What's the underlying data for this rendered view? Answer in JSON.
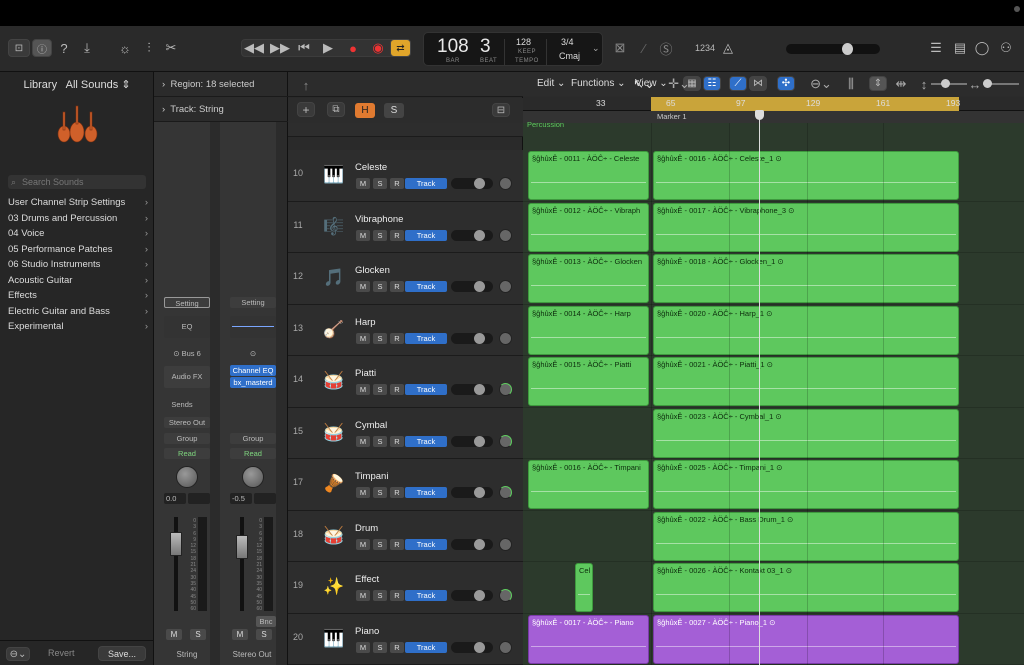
{
  "control_bar": {
    "tempo": "108",
    "bar": "3",
    "bar_label": "BAR",
    "beat_label": "BEAT",
    "tempo_value": "128",
    "keep_label": "KEEP",
    "tempo_label": "TEMPO",
    "signature": "3/4",
    "key": "Cmaj",
    "count_in": "1234"
  },
  "library": {
    "title": "Library",
    "filter": "All Sounds",
    "search_placeholder": "Search Sounds",
    "items": [
      {
        "label": "User Channel Strip Settings"
      },
      {
        "label": "03 Drums and Percussion"
      },
      {
        "label": "04 Voice"
      },
      {
        "label": "05 Performance Patches"
      },
      {
        "label": "06 Studio Instruments"
      },
      {
        "label": "Acoustic Guitar"
      },
      {
        "label": "Effects"
      },
      {
        "label": "Electric Guitar and Bass"
      },
      {
        "label": "Experimental"
      }
    ],
    "revert": "Revert",
    "save": "Save..."
  },
  "inspector": {
    "region_label": "Region:",
    "region_value": "18 selected",
    "track_label": "Track:",
    "track_value": "String",
    "strip1": {
      "setting": "Setting",
      "eq": "EQ",
      "bus": "Bus 6",
      "fx": "Audio FX",
      "sends": "Sends",
      "output": "Stereo Out",
      "group": "Group",
      "read": "Read",
      "vol": "0.0",
      "name": "String"
    },
    "strip2": {
      "setting": "Setting",
      "eq1": "Channel EQ",
      "eq2": "bx_masterd",
      "group": "Group",
      "read": "Read",
      "vol": "-0.5",
      "bnc": "Bnc",
      "name": "Stereo Out"
    },
    "mute": "M",
    "solo": "S",
    "scale": [
      "0",
      "3",
      "6",
      "9",
      "12",
      "15",
      "18",
      "21",
      "24",
      "30",
      "35",
      "40",
      "45",
      "50",
      "60"
    ]
  },
  "arrange_menu": {
    "edit": "Edit",
    "functions": "Functions",
    "view": "View"
  },
  "track_header_tools": {
    "h": "H",
    "s": "S"
  },
  "ruler": {
    "bars": [
      "33",
      "65",
      "97",
      "129",
      "161",
      "193"
    ],
    "marker": "Marker 1",
    "partial_track_label": "Percussion"
  },
  "tracks": [
    {
      "num": "10",
      "name": "Celeste",
      "icon": "🎹",
      "pan_green": false
    },
    {
      "num": "11",
      "name": "Vibraphone",
      "icon": "🎼",
      "pan_green": false
    },
    {
      "num": "12",
      "name": "Glocken",
      "icon": "🎵",
      "pan_green": false
    },
    {
      "num": "13",
      "name": "Harp",
      "icon": "🪕",
      "pan_green": false
    },
    {
      "num": "14",
      "name": "Piatti",
      "icon": "🥁",
      "pan_green": true
    },
    {
      "num": "15",
      "name": "Cymbal",
      "icon": "🥁",
      "pan_green": true
    },
    {
      "num": "17",
      "name": "Timpani",
      "icon": "🪘",
      "pan_green": true
    },
    {
      "num": "18",
      "name": "Drum",
      "icon": "🥁",
      "pan_green": false
    },
    {
      "num": "19",
      "name": "Effect",
      "icon": "✨",
      "pan_green": true
    },
    {
      "num": "20",
      "name": "Piano",
      "icon": "🎹",
      "pan_green": false
    }
  ],
  "track_buttons": {
    "m": "M",
    "s": "S",
    "r": "R",
    "track": "Track"
  },
  "regions": [
    {
      "lane": 0,
      "label": "§ĝhûxÊ - 0011 - ÀÖĈ÷ - Celeste",
      "start": 5,
      "width": 121,
      "purple": false
    },
    {
      "lane": 0,
      "label": "§ĝhûxÊ - 0016 - ÀÖĈ÷ - Celeste_1  ⊙",
      "start": 130,
      "width": 306,
      "purple": false
    },
    {
      "lane": 1,
      "label": "§ĝhûxÊ - 0012 - ÀÖĈ÷ - Vibraph",
      "start": 5,
      "width": 121,
      "purple": false
    },
    {
      "lane": 1,
      "label": "§ĝhûxÊ - 0017 - ÀÖĈ÷ - Vibraphone_3  ⊙",
      "start": 130,
      "width": 306,
      "purple": false
    },
    {
      "lane": 2,
      "label": "§ĝhûxÊ - 0013 - ÀÖĈ÷ - Glocken",
      "start": 5,
      "width": 121,
      "purple": false
    },
    {
      "lane": 2,
      "label": "§ĝhûxÊ - 0018 - ÀÖĈ÷ - Glocken_1  ⊙",
      "start": 130,
      "width": 306,
      "purple": false
    },
    {
      "lane": 3,
      "label": "§ĝhûxÊ - 0014 - ÀÖĈ÷ - Harp",
      "start": 5,
      "width": 121,
      "purple": false
    },
    {
      "lane": 3,
      "label": "§ĝhûxÊ - 0020 - ÀÖĈ÷ - Harp_1  ⊙",
      "start": 130,
      "width": 306,
      "purple": false
    },
    {
      "lane": 4,
      "label": "§ĝhûxÊ - 0015 - ÀÖĈ÷ - Piatti",
      "start": 5,
      "width": 121,
      "purple": false
    },
    {
      "lane": 4,
      "label": "§ĝhûxÊ - 0021 - ÀÖĈ÷ - Piatti_1  ⊙",
      "start": 130,
      "width": 306,
      "purple": false
    },
    {
      "lane": 5,
      "label": "§ĝhûxÊ - 0023 - ÀÖĈ÷ - Cymbal_1  ⊙",
      "start": 130,
      "width": 306,
      "purple": false
    },
    {
      "lane": 6,
      "label": "§ĝhûxÊ - 0016 - ÀÖĈ÷ - Timpani",
      "start": 5,
      "width": 121,
      "purple": false
    },
    {
      "lane": 6,
      "label": "§ĝhûxÊ - 0025 - ÀÖĈ÷ - Timpani_1  ⊙",
      "start": 130,
      "width": 306,
      "purple": false
    },
    {
      "lane": 7,
      "label": "§ĝhûxÊ - 0022 - ÀÖĈ÷ - Bass Drum_1  ⊙",
      "start": 130,
      "width": 306,
      "purple": false
    },
    {
      "lane": 8,
      "label": "Cel",
      "start": 52,
      "width": 18,
      "purple": false
    },
    {
      "lane": 8,
      "label": "§ĝhûxÊ - 0026 - ÀÖĈ÷ - Kontakt 03_1  ⊙",
      "start": 130,
      "width": 306,
      "purple": false
    },
    {
      "lane": 9,
      "label": "§ĝhûxÊ - 0017 - ÀÖĈ÷ - Piano",
      "start": 5,
      "width": 121,
      "purple": true
    },
    {
      "lane": 9,
      "label": "§ĝhûxÊ - 0027 - ÀÖĈ÷ - Piano_1  ⊙",
      "start": 130,
      "width": 306,
      "purple": true
    }
  ],
  "colors": {
    "region_green": "#5ec85e",
    "region_purple": "#a45fd6",
    "cycle": "#c9a43a",
    "track_button": "#2f6fc9"
  }
}
